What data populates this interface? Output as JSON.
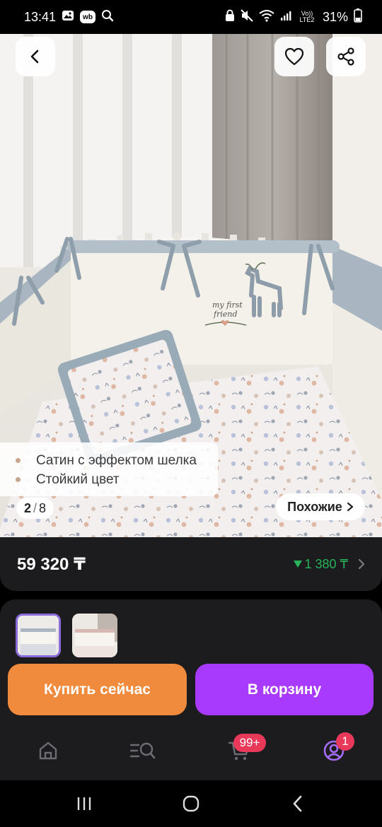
{
  "status_bar": {
    "time": "13:41",
    "left_chip": "wb",
    "lte": "Vo)) LTE2",
    "battery": "31%",
    "icons": [
      "gallery-icon",
      "wb-app-icon",
      "search-icon",
      "lock-icon",
      "mute-icon",
      "wifi-icon",
      "signal-icon",
      "battery-icon"
    ]
  },
  "hero": {
    "features": [
      "Сатин с эффектом шелка",
      "Стойкий цвет"
    ],
    "pager": {
      "current": "2",
      "separator": "/",
      "total": "8"
    },
    "similar_label": "Похожие",
    "embroidery": {
      "line1": "my first",
      "line2": "friend"
    }
  },
  "price": {
    "value": "59 320 ₸",
    "discount": "1 380 ₸",
    "discount_color": "#28b25a"
  },
  "actions": {
    "buy_now": "Купить сейчас",
    "add_to_cart": "В корзину",
    "buy_color": "#f08a3c",
    "cart_color": "#a73afd"
  },
  "nav": {
    "cart_badge": "99+",
    "profile_badge": "1",
    "icons": [
      "home-icon",
      "catalog-search-icon",
      "cart-icon",
      "profile-icon"
    ]
  }
}
